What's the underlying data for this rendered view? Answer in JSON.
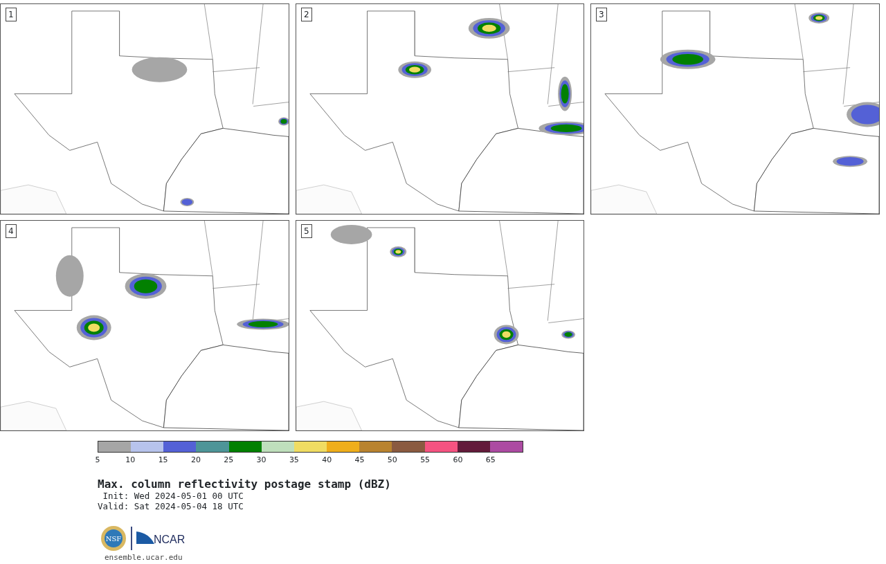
{
  "panels": [
    {
      "label": "1"
    },
    {
      "label": "2"
    },
    {
      "label": "3"
    },
    {
      "label": "4"
    },
    {
      "label": "5"
    }
  ],
  "colorbar": {
    "segments": [
      {
        "color": "#a6a6a6"
      },
      {
        "color": "#b7c3ec"
      },
      {
        "color": "#5461d6"
      },
      {
        "color": "#4e9598"
      },
      {
        "color": "#028001"
      },
      {
        "color": "#bfdfbc"
      },
      {
        "color": "#f0dc62"
      },
      {
        "color": "#efae1b"
      },
      {
        "color": "#b9832f"
      },
      {
        "color": "#8a5a40"
      },
      {
        "color": "#f55381"
      },
      {
        "color": "#621a3a"
      },
      {
        "color": "#ac4ba2"
      }
    ],
    "ticks": [
      "5",
      "10",
      "15",
      "20",
      "25",
      "30",
      "35",
      "40",
      "45",
      "50",
      "55",
      "60",
      "65"
    ]
  },
  "title": "Max. column reflectivity postage stamp (dBZ)",
  "init": " Init: Wed 2024-05-01 00 UTC",
  "valid": "Valid: Sat 2024-05-04 18 UTC",
  "logos": {
    "nsf": "NSF",
    "ncar": "NCAR"
  },
  "url": "ensemble.ucar.edu"
}
